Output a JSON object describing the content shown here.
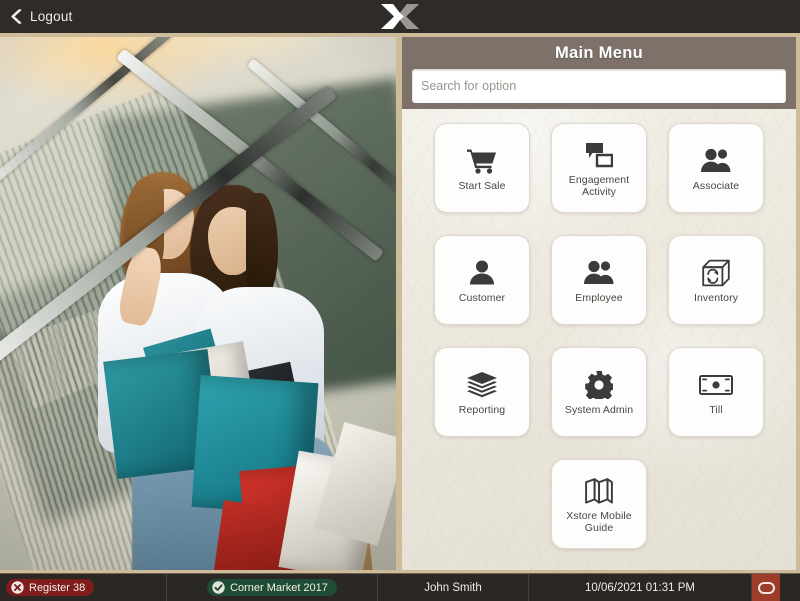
{
  "topbar": {
    "logout_label": "Logout",
    "back_icon": "chevron-left-icon",
    "logo_icon": "xstore-logo-icon"
  },
  "image_panel": {
    "alt": "two women with shopping bags on a mall escalator"
  },
  "menu": {
    "title": "Main Menu",
    "search": {
      "placeholder": "Search for option",
      "value": ""
    },
    "tiles": [
      {
        "label": "Start Sale",
        "icon": "shopping-cart-icon"
      },
      {
        "label": "Engagement Activity",
        "icon": "speech-bubbles-icon"
      },
      {
        "label": "Associate",
        "icon": "two-people-icon"
      },
      {
        "label": "Customer",
        "icon": "person-icon"
      },
      {
        "label": "Employee",
        "icon": "two-people-icon"
      },
      {
        "label": "Inventory",
        "icon": "box-refresh-icon"
      },
      {
        "label": "Reporting",
        "icon": "stacked-layers-icon"
      },
      {
        "label": "System Admin",
        "icon": "gear-icon"
      },
      {
        "label": "Till",
        "icon": "banknote-icon"
      },
      {
        "label": "Xstore Mobile Guide",
        "icon": "map-icon"
      }
    ]
  },
  "statusbar": {
    "register": {
      "label": "Register 38",
      "icon": "error-circle-x-icon",
      "color": "#7e1d1c"
    },
    "store": {
      "label": "Corner Market 2017",
      "icon": "check-circle-icon",
      "color": "#1f4c35"
    },
    "user": "John Smith",
    "datetime": "10/06/2021 01:31 PM",
    "connection_icon": "oval-indicator-icon",
    "connection_color": "#9b3d2a"
  }
}
